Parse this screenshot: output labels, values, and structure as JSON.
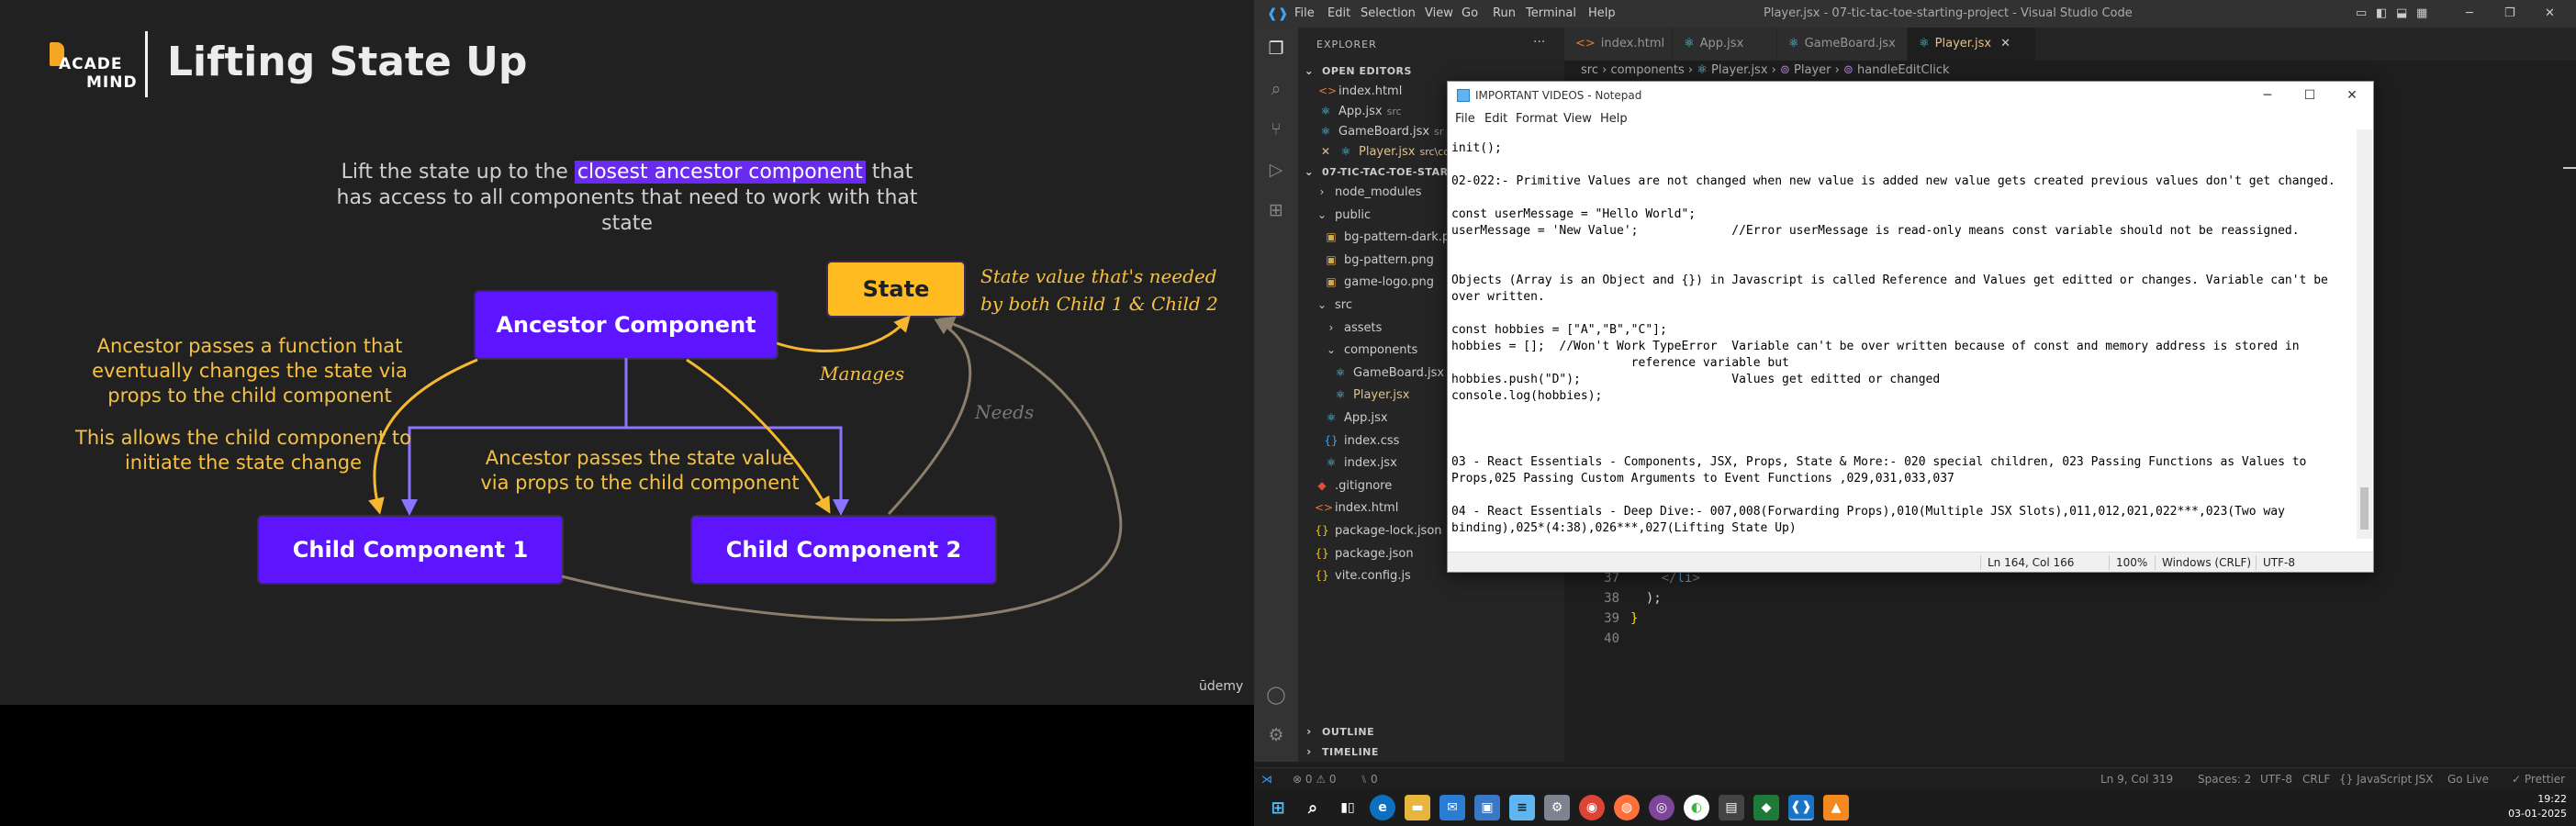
{
  "slide": {
    "logo_line1": "ACADE",
    "logo_line2": "MIND",
    "title": "Lifting State Up",
    "subtitle_pre": "Lift the state up to the",
    "subtitle_highlight": "closest ancestor component",
    "subtitle_post": "that has access to all components that need to work with that state",
    "ancestor_label": "Ancestor Component",
    "state_label": "State",
    "child1_label": "Child Component 1",
    "child2_label": "Child Component 2",
    "note_function": "Ancestor passes a function that eventually changes the state via props to the child component",
    "note_allows": "This allows the child component to initiate the state change",
    "note_passes": "Ancestor passes the state value via props to the child component",
    "note_manages": "Manages",
    "note_needs": "Needs",
    "note_state": "State value that's needed by both Child 1 & Child 2",
    "brand": "ūdemy",
    "colors": {
      "purple": "#5d14ff",
      "yellow": "#ffbb1f",
      "arrow_purple": "#8d74ff",
      "arrow_yellow": "#f5b82e",
      "arrow_gray": "#8b7e6a"
    }
  },
  "vscode": {
    "title": "Player.jsx - 07-tic-tac-toe-starting-project - Visual Studio Code",
    "menu": [
      "File",
      "Edit",
      "Selection",
      "View",
      "Go",
      "Run",
      "Terminal",
      "Help"
    ],
    "explorer_title": "EXPLORER",
    "open_editors_label": "OPEN EDITORS",
    "open_editors": [
      {
        "name": "index.html",
        "hint": "",
        "icon": "html-icon"
      },
      {
        "name": "App.jsx",
        "hint": "src",
        "icon": "react-icon"
      },
      {
        "name": "GameBoard.jsx",
        "hint": "sr",
        "icon": "react-icon"
      },
      {
        "name": "Player.jsx",
        "hint": "src\\com",
        "icon": "react-icon"
      }
    ],
    "project_label": "07-TIC-TAC-TOE-STARTING",
    "tree": [
      {
        "name": "node_modules",
        "type": "folder-closed",
        "depth": 1
      },
      {
        "name": "public",
        "type": "folder-open",
        "depth": 1
      },
      {
        "name": "bg-pattern-dark.png",
        "type": "png",
        "depth": 2
      },
      {
        "name": "bg-pattern.png",
        "type": "png",
        "depth": 2
      },
      {
        "name": "game-logo.png",
        "type": "png",
        "depth": 2
      },
      {
        "name": "src",
        "type": "folder-open",
        "depth": 1
      },
      {
        "name": "assets",
        "type": "folder-closed",
        "depth": 2
      },
      {
        "name": "components",
        "type": "folder-open",
        "depth": 2
      },
      {
        "name": "GameBoard.jsx",
        "type": "jsx",
        "depth": 3
      },
      {
        "name": "Player.jsx",
        "type": "jsx",
        "depth": 3,
        "selected": true
      },
      {
        "name": "App.jsx",
        "type": "jsx",
        "depth": 2
      },
      {
        "name": "index.css",
        "type": "css",
        "depth": 2
      },
      {
        "name": "index.jsx",
        "type": "jsx",
        "depth": 2
      },
      {
        "name": ".gitignore",
        "type": "git",
        "depth": 1
      },
      {
        "name": "index.html",
        "type": "html",
        "depth": 1
      },
      {
        "name": "package-lock.json",
        "type": "json",
        "depth": 1
      },
      {
        "name": "package.json",
        "type": "json",
        "depth": 1
      },
      {
        "name": "vite.config.js",
        "type": "js",
        "depth": 1
      }
    ],
    "tabs": [
      {
        "name": "index.html",
        "icon": "html-icon",
        "active": false
      },
      {
        "name": "App.jsx",
        "icon": "react-icon",
        "active": false
      },
      {
        "name": "GameBoard.jsx",
        "icon": "react-icon",
        "active": false
      },
      {
        "name": "Player.jsx",
        "icon": "react-icon",
        "active": true
      }
    ],
    "breadcrumbs": [
      "src",
      "components",
      "Player.jsx",
      "Player",
      "handleEditClick"
    ],
    "code_lines": [
      {
        "n": "37",
        "text": "    </li>"
      },
      {
        "n": "38",
        "text": "  );"
      },
      {
        "n": "39",
        "text": "}"
      },
      {
        "n": "40",
        "text": ""
      }
    ],
    "outline_label": "OUTLINE",
    "timeline_label": "TIMELINE",
    "status_left": [
      "⊗ 0 ⚠ 0",
      "⑊ 0"
    ],
    "status_right": [
      "Ln 9, Col 319",
      "Spaces: 2",
      "UTF-8",
      "CRLF",
      "{} JavaScript JSX",
      "Go Live",
      "✓ Prettier"
    ]
  },
  "notepad": {
    "title": "IMPORTANT VIDEOS - Notepad",
    "menu": [
      "File",
      "Edit",
      "Format",
      "View",
      "Help"
    ],
    "lines": [
      "init();",
      "",
      "02-022:- Primitive Values are not changed when new value is added new value gets created previous values don't get changed.",
      "",
      "const userMessage = \"Hello World\";",
      "userMessage = 'New Value';             //Error userMessage is read-only means const variable should not be reassigned.",
      "",
      "",
      "Objects (Array is an Object and {}) in Javascript is called Reference and Values get editted or changes. Variable can't be",
      "over written.",
      "",
      "const hobbies = [\"A\",\"B\",\"C\"];",
      "hobbies = [];  //Won't Work TypeError  Variable can't be over written because of const and memory address is stored in",
      "                         reference variable but",
      "hobbies.push(\"D\");                     Values get editted or changed",
      "console.log(hobbies);",
      "",
      "",
      "",
      "03 - React Essentials - Components, JSX, Props, State & More:- 020 special children, 023 Passing Functions as Values to",
      "Props,025 Passing Custom Arguments to Event Functions ,029,031,033,037",
      "",
      "04 - React Essentials - Deep Dive:- 007,008(Forwarding Props),010(Multiple JSX Slots),011,012,021,022***,023(Two way",
      "binding),025*(4:38),026***,027(Lifting State Up)"
    ],
    "status_position": "Ln 164, Col 166",
    "status_zoom": "100%",
    "status_eol": "Windows (CRLF)",
    "status_encoding": "UTF-8"
  },
  "taskbar": {
    "time": "19:22",
    "date": "03-01-2025",
    "apps": [
      "windows-start",
      "search",
      "task-view",
      "edge",
      "file-explorer",
      "mail",
      "remote-desktop",
      "notepad",
      "settings",
      "chrome",
      "firefox",
      "tor",
      "brave",
      "word",
      "store",
      "vscode",
      "vlc"
    ]
  }
}
